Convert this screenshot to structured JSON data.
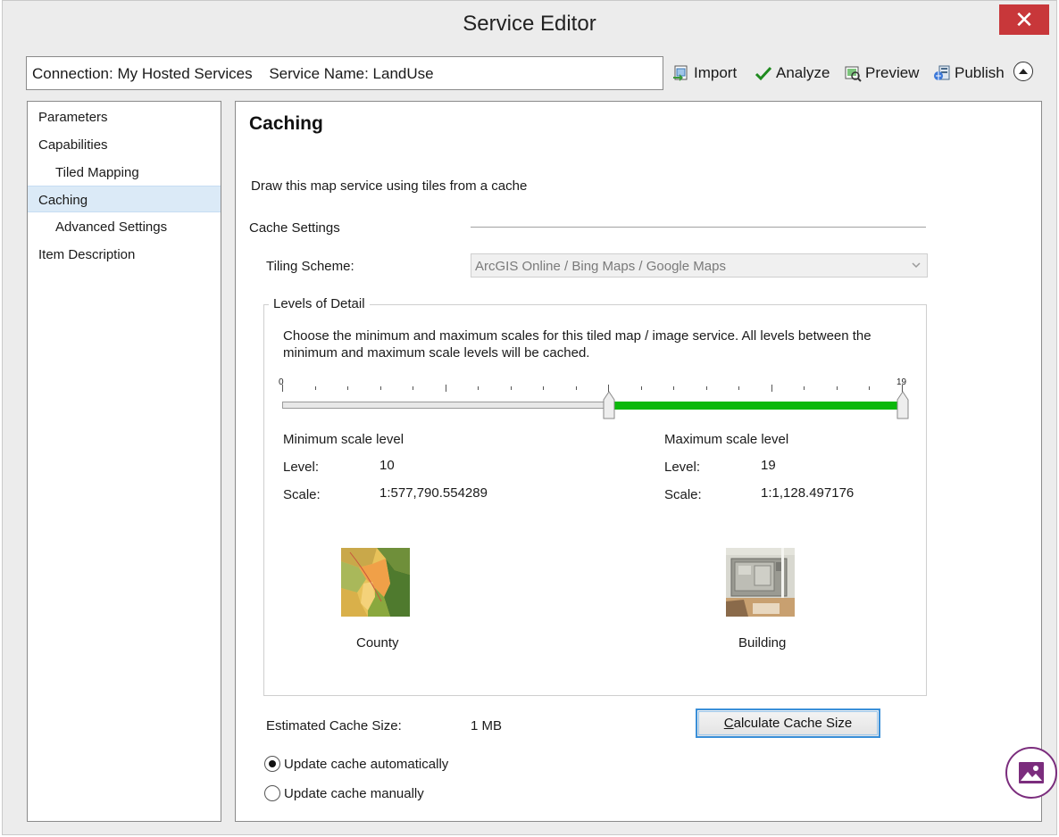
{
  "window": {
    "title": "Service Editor",
    "close_glyph": "✕"
  },
  "connection": {
    "connection_text": "Connection: My Hosted Services",
    "service_text": "Service Name: LandUse"
  },
  "toolbar": {
    "import_label": "Import",
    "analyze_label": "Analyze",
    "preview_label": "Preview",
    "publish_label": "Publish",
    "collapse_icon": "chevron-up-circle-icon"
  },
  "sidebar": {
    "items": [
      {
        "label": "Parameters"
      },
      {
        "label": "Capabilities"
      },
      {
        "label": "Tiled Mapping"
      },
      {
        "label": "Caching"
      },
      {
        "label": "Advanced Settings"
      },
      {
        "label": "Item Description"
      }
    ],
    "selected": "Caching"
  },
  "main": {
    "heading": "Caching",
    "draw_option": "Draw this map service using tiles from a cache",
    "cache_settings_label": "Cache Settings",
    "tiling_scheme_label": "Tiling Scheme:",
    "tiling_scheme_value": "ArcGIS Online / Bing Maps / Google Maps",
    "lod": {
      "legend": "Levels of Detail",
      "description_line1": "Choose the minimum and maximum scales for this tiled map / image service. All levels between the",
      "description_line2": "minimum and maximum scale levels will be cached.",
      "slider": {
        "min_label": "0",
        "max_label": "19",
        "range_min": 0,
        "range_max": 19,
        "selected_min": 10,
        "selected_max": 19,
        "selected_color": "#0bb80b"
      },
      "min_scale": {
        "heading": "Minimum scale level",
        "level_label": "Level:",
        "level_value": "10",
        "scale_label": "Scale:",
        "scale_value": "1:577,790.554289",
        "caption": "County"
      },
      "max_scale": {
        "heading": "Maximum scale level",
        "level_label": "Level:",
        "level_value": "19",
        "scale_label": "Scale:",
        "scale_value": "1:1,128.497176",
        "caption": "Building"
      }
    },
    "estimated_cache_label": "Estimated Cache Size:",
    "estimated_cache_value": "1 MB",
    "calculate_button": {
      "mnemonic": "C",
      "rest": "alculate Cache Size"
    },
    "update_auto_label": "Update cache automatically",
    "update_manual_label": "Update cache manually",
    "update_mode": "automatically"
  },
  "colors": {
    "accent_blue": "#3a8fd8",
    "close_red": "#c8373a",
    "badge_purple": "#7b2d7d"
  }
}
